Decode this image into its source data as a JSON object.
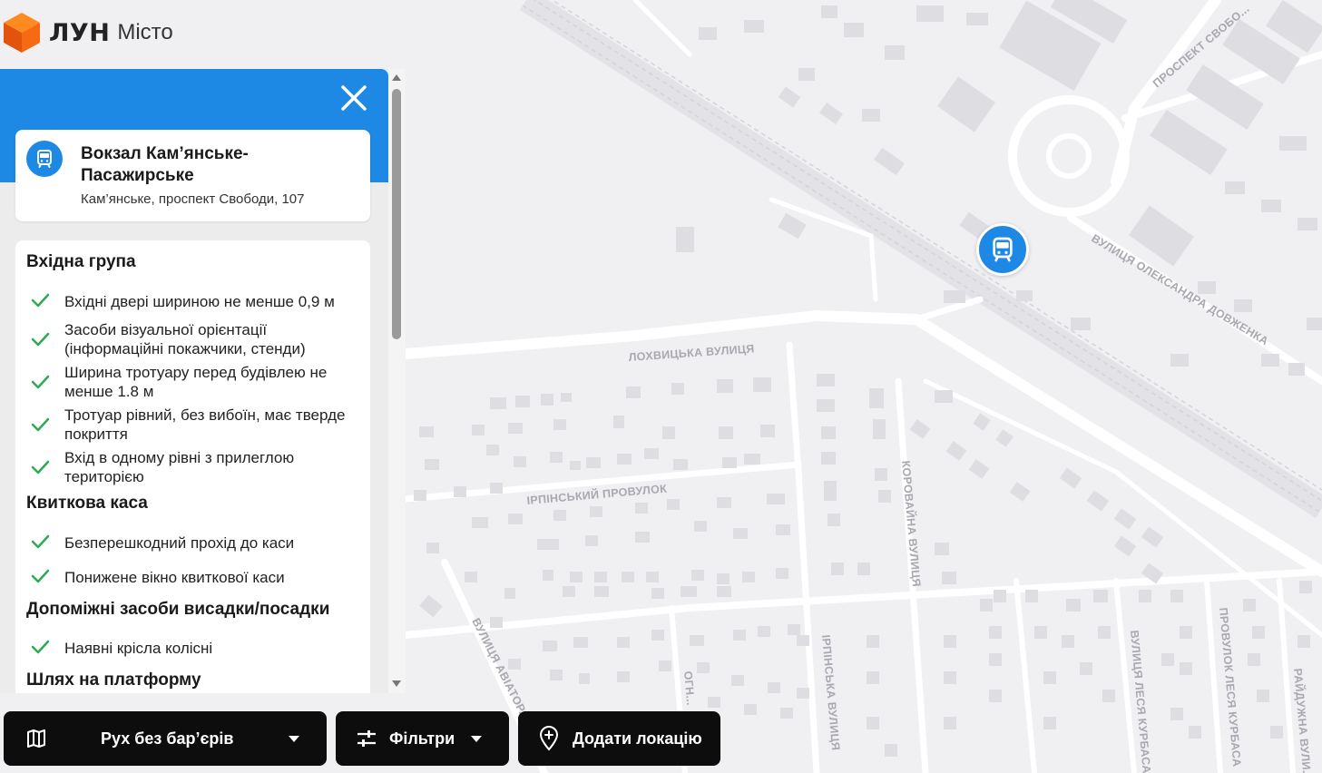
{
  "app": {
    "logo_name": "ЛУН",
    "logo_sub": "Місто"
  },
  "place": {
    "title": "Вокзал Кам’янське-Пасажирське",
    "address": "Кам’янське, проспект Свободи, 107",
    "icon": "train-icon"
  },
  "sections": [
    {
      "title": "Вхідна група",
      "items": [
        "Вхідні двері шириною не менше 0,9 м",
        "Засоби візуальної орієнтації (інформаційні покажчики, стенди)",
        "Ширина тротуару перед будівлею не менше 1.8 м",
        "Тротуар рівний, без вибоїн, має тверде покриття",
        "Вхід в одному рівні з прилеглою територією"
      ]
    },
    {
      "title": "Квиткова каса",
      "items": [
        "Безперешкодний прохід до каси",
        "Понижене вікно квиткової каси"
      ]
    },
    {
      "title": "Допоміжні засоби висадки/посадки",
      "items": [
        "Наявні крісла колісні"
      ]
    },
    {
      "title": "Шлях на платформу",
      "items": []
    }
  ],
  "toolbar": {
    "layer_label": "Рух без бар’єрів",
    "filters_label": "Фільтри",
    "add_label": "Додати локацію"
  },
  "map": {
    "streets": [
      "ПРОСПЕКТ СВОБО...",
      "ВУЛИЦЯ ОЛЕКСАНДРА ДОВЖЕНКА",
      "ЛОХВИЦЬКА ВУЛИЦЯ",
      "ІРПІНСЬКИЙ ПРОВУЛОК",
      "КОРОВАЙНА ВУЛИЦЯ",
      "ВУЛИЦЯ АВІАТОР...",
      "ОГН...",
      "ІРПІНСЬКА ВУЛИЦЯ",
      "ВУЛИЦЯ ЛЕСЯ КУРБАСА",
      "ПРОВУЛОК ЛЕСЯ КУРБАСА",
      "РАЙДУЖНА ВУЛИ..."
    ]
  },
  "colors": {
    "accent": "#1e88e5",
    "check": "#2eaa55",
    "map_bg": "#f0f0f2",
    "building": "#dedee2",
    "button_bg": "#0d0d0d"
  }
}
